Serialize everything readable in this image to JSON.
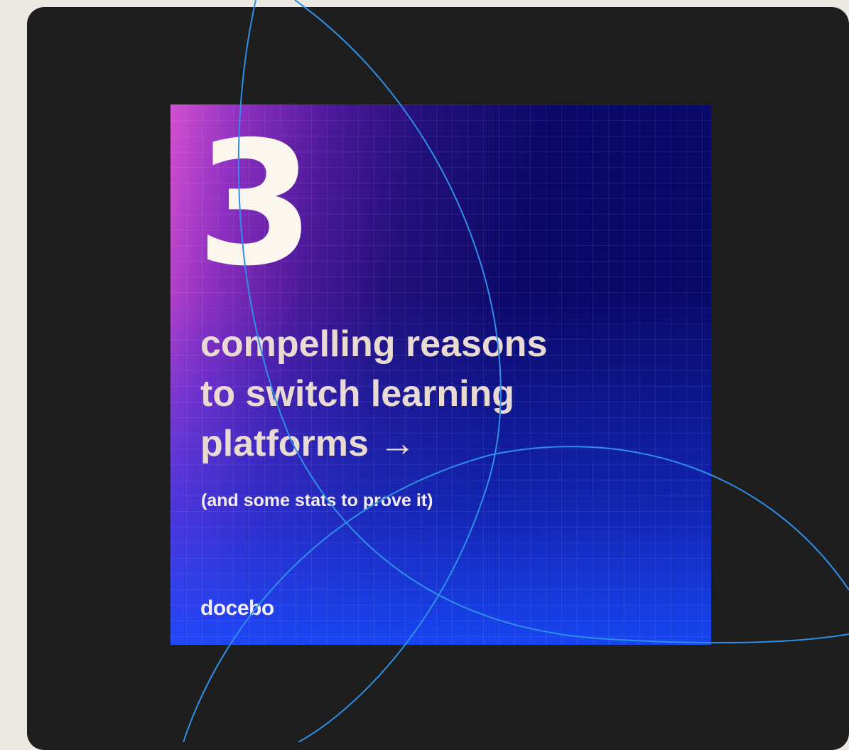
{
  "card": {
    "number": "3",
    "headline_lines": [
      "compelling reasons",
      "to switch learning",
      "platforms →"
    ],
    "subline": "(and some stats to prove it)",
    "brand": "docebo"
  },
  "colors": {
    "page_background": "#ece9e2",
    "panel_background": "#1e1e1e",
    "gradient_magenta": "#d24fcf",
    "gradient_navy": "#070a6a",
    "gradient_blue": "#194bff",
    "arc_stroke": "#2f8fe8",
    "headline_text": "#eadbd2"
  }
}
